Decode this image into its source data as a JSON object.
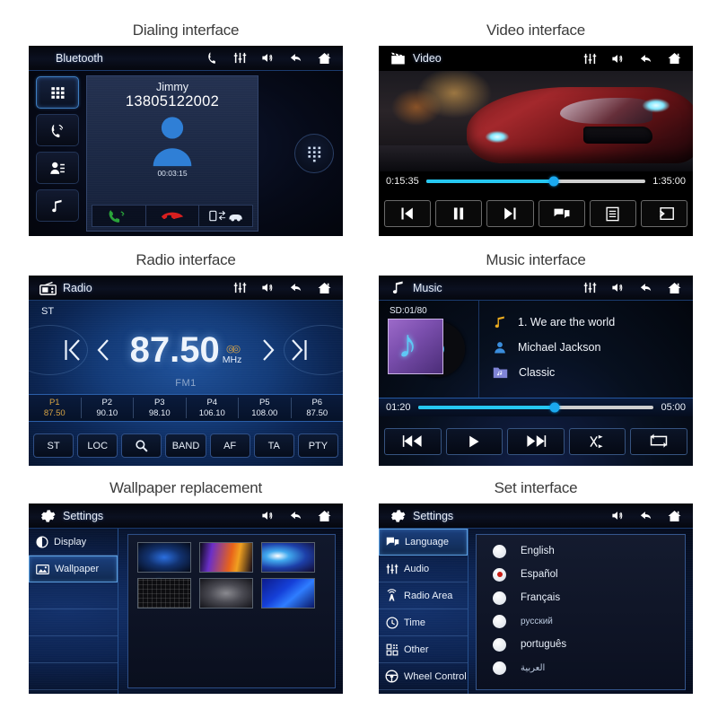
{
  "panels": [
    {
      "title": "Dialing interface",
      "header": {
        "title": "Bluetooth",
        "app_icon": "bluetooth-label"
      },
      "header_icons": [
        "phone-icon",
        "equalizer-icon",
        "volume-icon",
        "back-arrow-icon",
        "home-icon"
      ],
      "side_buttons": [
        "keypad-icon",
        "call-log-icon",
        "contacts-icon",
        "music-note-icon"
      ],
      "contact_name": "Jimmy",
      "phone_number": "13805122002",
      "call_timer": "00:03:15",
      "actions": [
        "answer-call-icon",
        "end-call-icon",
        "phone-to-car-transfer-icon"
      ],
      "keypad_round": "keypad-icon"
    },
    {
      "title": "Video interface",
      "header": {
        "title": "Video",
        "app_icon": "clapperboard-icon"
      },
      "header_icons": [
        "equalizer-icon",
        "volume-icon",
        "back-arrow-icon",
        "home-icon"
      ],
      "elapsed": "0:15:35",
      "duration": "1:35:00",
      "progress_percent": 58,
      "controls": [
        "previous-track-icon",
        "pause-icon",
        "next-track-icon",
        "subtitle-icon",
        "playlist-icon",
        "screen-mirror-icon"
      ]
    },
    {
      "title": "Radio interface",
      "header": {
        "title": "Radio",
        "app_icon": "radio-icon"
      },
      "header_icons": [
        "equalizer-icon",
        "volume-icon",
        "back-arrow-icon",
        "home-icon"
      ],
      "stereo_label": "ST",
      "frequency": "87.50",
      "unit": "MHz",
      "band": "FM1",
      "tuning": [
        "seek-prev-icon",
        "step-prev-icon",
        "step-next-icon",
        "seek-next-icon"
      ],
      "presets": [
        {
          "name": "P1",
          "freq": "87.50",
          "selected": true
        },
        {
          "name": "P2",
          "freq": "90.10",
          "selected": false
        },
        {
          "name": "P3",
          "freq": "98.10",
          "selected": false
        },
        {
          "name": "P4",
          "freq": "106.10",
          "selected": false
        },
        {
          "name": "P5",
          "freq": "108.00",
          "selected": false
        },
        {
          "name": "P6",
          "freq": "87.50",
          "selected": false
        }
      ],
      "buttons": [
        "ST",
        "LOC",
        "search-icon",
        "BAND",
        "AF",
        "TA",
        "PTY"
      ]
    },
    {
      "title": "Music interface",
      "header": {
        "title": "Music",
        "app_icon": "music-note-icon"
      },
      "header_icons": [
        "equalizer-icon",
        "volume-icon",
        "back-arrow-icon",
        "home-icon"
      ],
      "source_counter": "SD:01/80",
      "track": "1.  We are the world",
      "artist": "Michael Jackson",
      "album": "Classic",
      "elapsed": "01:20",
      "duration": "05:00",
      "progress_percent": 58,
      "controls": [
        "previous-track-icon",
        "play-icon",
        "next-track-icon",
        "shuffle-icon",
        "repeat-icon"
      ]
    },
    {
      "title": "Wallpaper replacement",
      "header": {
        "title": "Settings",
        "app_icon": "gear-icon"
      },
      "header_icons": [
        "volume-icon",
        "back-arrow-icon",
        "home-icon"
      ],
      "side_items": [
        {
          "label": "Display",
          "icon": "contrast-icon",
          "active": false
        },
        {
          "label": "Wallpaper",
          "icon": "image-icon",
          "active": true
        }
      ],
      "empty_rows": 4,
      "thumbnails": [
        {
          "id": "wallpaper-blue-glow",
          "selected": true
        },
        {
          "id": "wallpaper-neon-waves",
          "selected": false
        },
        {
          "id": "wallpaper-cyan-swirl",
          "selected": false
        },
        {
          "id": "wallpaper-dark-grid",
          "selected": false
        },
        {
          "id": "wallpaper-grey-gradient",
          "selected": false
        },
        {
          "id": "wallpaper-blue-streak",
          "selected": false
        }
      ],
      "check_glyph": "✔"
    },
    {
      "title": "Set interface",
      "header": {
        "title": "Settings",
        "app_icon": "gear-icon"
      },
      "header_icons": [
        "volume-icon",
        "back-arrow-icon",
        "home-icon"
      ],
      "side_items": [
        {
          "label": "Language",
          "icon": "speech-bubble-icon",
          "active": true
        },
        {
          "label": "Audio",
          "icon": "equalizer-icon",
          "active": false
        },
        {
          "label": "Radio Area",
          "icon": "antenna-icon",
          "active": false
        },
        {
          "label": "Time",
          "icon": "clock-icon",
          "active": false
        },
        {
          "label": "Other",
          "icon": "grid-blocks-icon",
          "active": false
        },
        {
          "label": "Wheel Control",
          "icon": "steering-wheel-icon",
          "active": false
        }
      ],
      "languages": [
        {
          "label": "English",
          "selected": false,
          "dim": false
        },
        {
          "label": "Español",
          "selected": true,
          "dim": false
        },
        {
          "label": "Français",
          "selected": false,
          "dim": false
        },
        {
          "label": "русский",
          "selected": false,
          "dim": true
        },
        {
          "label": "português",
          "selected": false,
          "dim": false
        },
        {
          "label": "العربية",
          "selected": false,
          "dim": true
        }
      ]
    }
  ],
  "colors": {
    "accent_cyan": "#26c8f2",
    "accent_gold": "#d8a443",
    "radio_red": "#c81c14",
    "answer_green": "#2aa43a",
    "end_red": "#d81f1f",
    "panel_blue": "#123a78"
  }
}
